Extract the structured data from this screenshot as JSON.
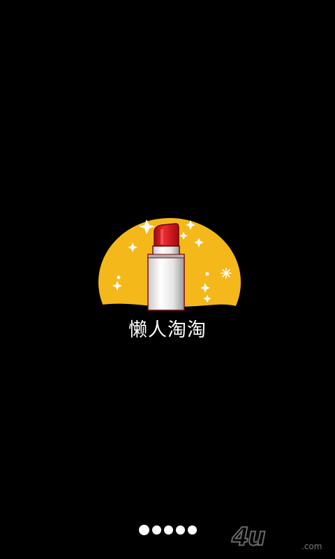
{
  "app": {
    "name": "懒人淘淘"
  },
  "pager": {
    "count": 5,
    "active_index": 0
  },
  "watermark": {
    "text": "4u",
    "suffix": ".com"
  },
  "colors": {
    "background": "#000000",
    "logo_yellow": "#F5B81A",
    "lipstick_red": "#D8141B",
    "text": "#FFFFFF"
  },
  "icons": {
    "logo": "lipstick-logo-icon",
    "sparkle": "sparkle-icon"
  }
}
